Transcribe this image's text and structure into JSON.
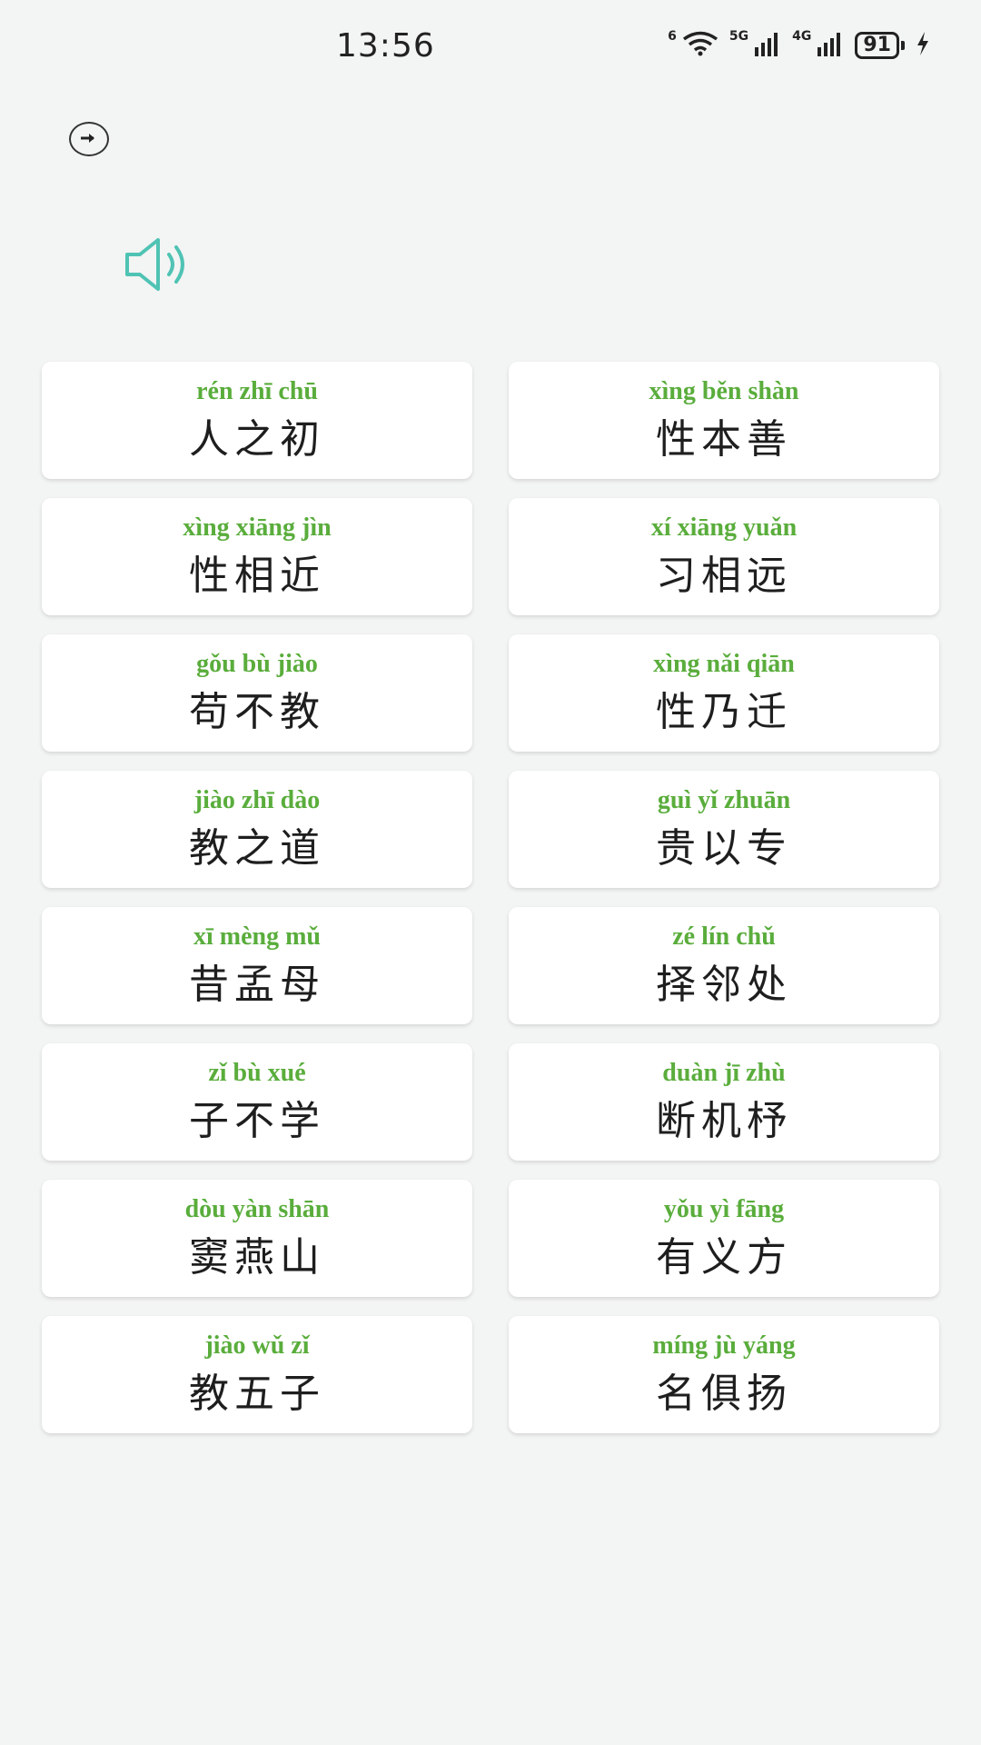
{
  "status_bar": {
    "time": "13:56",
    "wifi_label": "6",
    "net1_label": "5G",
    "net2_label": "4G",
    "battery": "91"
  },
  "colors": {
    "pinyin": "#5aad3c",
    "speaker": "#4fc3b4",
    "background": "#f3f4f4"
  },
  "cards": [
    {
      "pinyin": "rén zhī chū",
      "hanzi": "人之初"
    },
    {
      "pinyin": "xìng běn shàn",
      "hanzi": "性本善"
    },
    {
      "pinyin": "xìng xiāng jìn",
      "hanzi": "性相近"
    },
    {
      "pinyin": "xí xiāng yuǎn",
      "hanzi": "习相远"
    },
    {
      "pinyin": "gǒu bù jiào",
      "hanzi": "苟不教"
    },
    {
      "pinyin": "xìng nǎi qiān",
      "hanzi": "性乃迁"
    },
    {
      "pinyin": "jiào zhī dào",
      "hanzi": "教之道"
    },
    {
      "pinyin": "guì yǐ zhuān",
      "hanzi": "贵以专"
    },
    {
      "pinyin": "xī mèng mǔ",
      "hanzi": "昔孟母"
    },
    {
      "pinyin": "zé lín chǔ",
      "hanzi": "择邻处"
    },
    {
      "pinyin": "zǐ bù xué",
      "hanzi": "子不学"
    },
    {
      "pinyin": "duàn jī zhù",
      "hanzi": "断机杼"
    },
    {
      "pinyin": "dòu yàn shān",
      "hanzi": "窦燕山"
    },
    {
      "pinyin": "yǒu yì fāng",
      "hanzi": "有义方"
    },
    {
      "pinyin": "jiào wǔ zǐ",
      "hanzi": "教五子"
    },
    {
      "pinyin": "míng jù yáng",
      "hanzi": "名俱扬"
    }
  ]
}
